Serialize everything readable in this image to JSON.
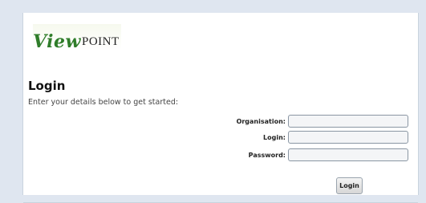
{
  "logo": {
    "script": "View",
    "caps": "POINT"
  },
  "heading": {
    "title": "Login",
    "subtitle": "Enter your details below to get started:"
  },
  "form": {
    "organisation_label": "Organisation:",
    "login_label": "Login:",
    "password_label": "Password:",
    "organisation_value": "",
    "login_value": "",
    "password_value": "",
    "submit_label": "Login"
  }
}
